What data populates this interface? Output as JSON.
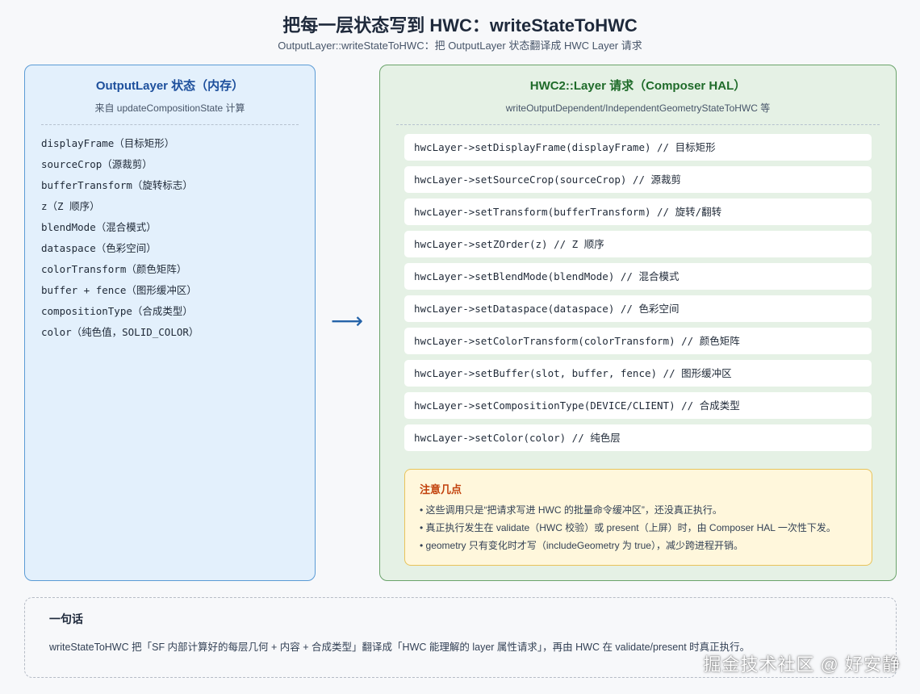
{
  "header": {
    "title": "把每一层状态写到 HWC：writeStateToHWC",
    "subtitle": "OutputLayer::writeStateToHWC：把 OutputLayer 状态翻译成 HWC Layer 请求"
  },
  "left_panel": {
    "title": "OutputLayer 状态（内存）",
    "subtitle": "来自 updateCompositionState 计算",
    "items": [
      "displayFrame（目标矩形）",
      "sourceCrop（源裁剪）",
      "bufferTransform（旋转标志）",
      "z（Z 顺序）",
      "blendMode（混合模式）",
      "dataspace（色彩空间）",
      "colorTransform（颜色矩阵）",
      "buffer + fence（图形缓冲区）",
      "compositionType（合成类型）",
      "color（纯色值，SOLID_COLOR）"
    ]
  },
  "arrow": "⟶",
  "right_panel": {
    "title": "HWC2::Layer 请求（Composer HAL）",
    "subtitle": "writeOutputDependent/IndependentGeometryStateToHWC 等",
    "calls": [
      "hwcLayer->setDisplayFrame(displayFrame) // 目标矩形",
      "hwcLayer->setSourceCrop(sourceCrop) // 源裁剪",
      "hwcLayer->setTransform(bufferTransform) // 旋转/翻转",
      "hwcLayer->setZOrder(z) // Z 顺序",
      "hwcLayer->setBlendMode(blendMode) // 混合模式",
      "hwcLayer->setDataspace(dataspace) // 色彩空间",
      "hwcLayer->setColorTransform(colorTransform) // 颜色矩阵",
      "hwcLayer->setBuffer(slot, buffer, fence) // 图形缓冲区",
      "hwcLayer->setCompositionType(DEVICE/CLIENT) // 合成类型",
      "hwcLayer->setColor(color) // 纯色层"
    ],
    "notes": {
      "title": "注意几点",
      "items": [
        "• 这些调用只是“把请求写进 HWC 的批量命令缓冲区”，还没真正执行。",
        "• 真正执行发生在 validate（HWC 校验）或 present（上屏）时，由 Composer HAL 一次性下发。",
        "• geometry 只有变化时才写（includeGeometry 为 true），减少跨进程开销。"
      ]
    }
  },
  "summary": {
    "title": "一句话",
    "body": "writeStateToHWC 把「SF 内部计算好的每层几何 + 内容 + 合成类型」翻译成「HWC 能理解的 layer 属性请求」，再由 HWC 在 validate/present 时真正执行。"
  },
  "watermark": "掘金技术社区 @ 好安静"
}
